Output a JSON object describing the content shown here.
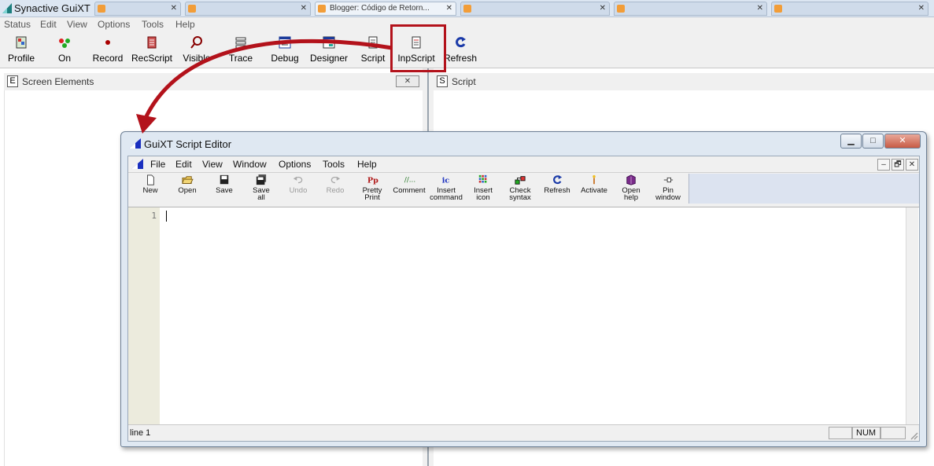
{
  "app": {
    "title": "Synactive GuiXT"
  },
  "browser_tabs": [
    {
      "label": "",
      "active": false
    },
    {
      "label": "",
      "active": false
    },
    {
      "label": "Blogger: Código de Retorn...",
      "active": true
    },
    {
      "label": "",
      "active": false
    },
    {
      "label": "",
      "active": false
    },
    {
      "label": "",
      "active": false
    }
  ],
  "menu": [
    "Status",
    "Edit",
    "View",
    "Options",
    "Tools",
    "Help"
  ],
  "toolbar": [
    {
      "label": "Profile",
      "icon": "profile-icon"
    },
    {
      "label": "On",
      "icon": "on-icon"
    },
    {
      "label": "Record",
      "icon": "record-icon"
    },
    {
      "label": "RecScript",
      "icon": "recscript-icon"
    },
    {
      "label": "Visible",
      "icon": "visible-icon"
    },
    {
      "label": "Trace",
      "icon": "trace-icon"
    },
    {
      "label": "Debug",
      "icon": "debug-icon"
    },
    {
      "label": "Designer",
      "icon": "designer-icon"
    },
    {
      "label": "Script",
      "icon": "script-icon"
    },
    {
      "label": "InpScript",
      "icon": "inpscript-icon"
    },
    {
      "label": "Refresh",
      "icon": "refresh-icon"
    }
  ],
  "panes": {
    "left": {
      "letter": "E",
      "title": "Screen Elements",
      "close": "✕"
    },
    "right": {
      "letter": "S",
      "title": "Script"
    }
  },
  "editor": {
    "title": "GuiXT Script Editor",
    "window_buttons": {
      "minimize": "▁",
      "maximize": "□",
      "close": "✕"
    },
    "menu": [
      "File",
      "Edit",
      "View",
      "Window",
      "Options",
      "Tools",
      "Help"
    ],
    "mdi_buttons": {
      "minimize": "–",
      "restore": "🗗",
      "close": "✕"
    },
    "toolbar": [
      {
        "line1": "New",
        "line2": "",
        "icon": "new-file-icon",
        "enabled": true
      },
      {
        "line1": "Open",
        "line2": "",
        "icon": "open-folder-icon",
        "enabled": true
      },
      {
        "line1": "Save",
        "line2": "",
        "icon": "save-icon",
        "enabled": true
      },
      {
        "line1": "Save",
        "line2": "all",
        "icon": "save-all-icon",
        "enabled": true
      },
      {
        "line1": "Undo",
        "line2": "",
        "icon": "undo-icon",
        "enabled": false
      },
      {
        "line1": "Redo",
        "line2": "",
        "icon": "redo-icon",
        "enabled": false
      },
      {
        "line1": "Pretty",
        "line2": "Print",
        "icon": "pretty-print-icon",
        "enabled": true
      },
      {
        "line1": "Comment",
        "line2": "",
        "icon": "comment-icon",
        "enabled": true
      },
      {
        "line1": "Insert",
        "line2": "command",
        "icon": "insert-command-icon",
        "enabled": true
      },
      {
        "line1": "Insert",
        "line2": "icon",
        "icon": "insert-icon-icon",
        "enabled": true
      },
      {
        "line1": "Check",
        "line2": "syntax",
        "icon": "check-syntax-icon",
        "enabled": true
      },
      {
        "line1": "Refresh",
        "line2": "",
        "icon": "refresh-icon",
        "enabled": true
      },
      {
        "line1": "Activate",
        "line2": "",
        "icon": "activate-icon",
        "enabled": true
      },
      {
        "line1": "Open",
        "line2": "help",
        "icon": "open-help-icon",
        "enabled": true
      },
      {
        "line1": "Pin",
        "line2": "window",
        "icon": "pin-icon",
        "enabled": true
      }
    ],
    "gutter_line": "1",
    "status": {
      "line": "line 1",
      "box1": "",
      "num": "NUM",
      "box3": ""
    }
  },
  "colors": {
    "callout": "#b3121b",
    "editor_frame": "#dfe8f2"
  }
}
